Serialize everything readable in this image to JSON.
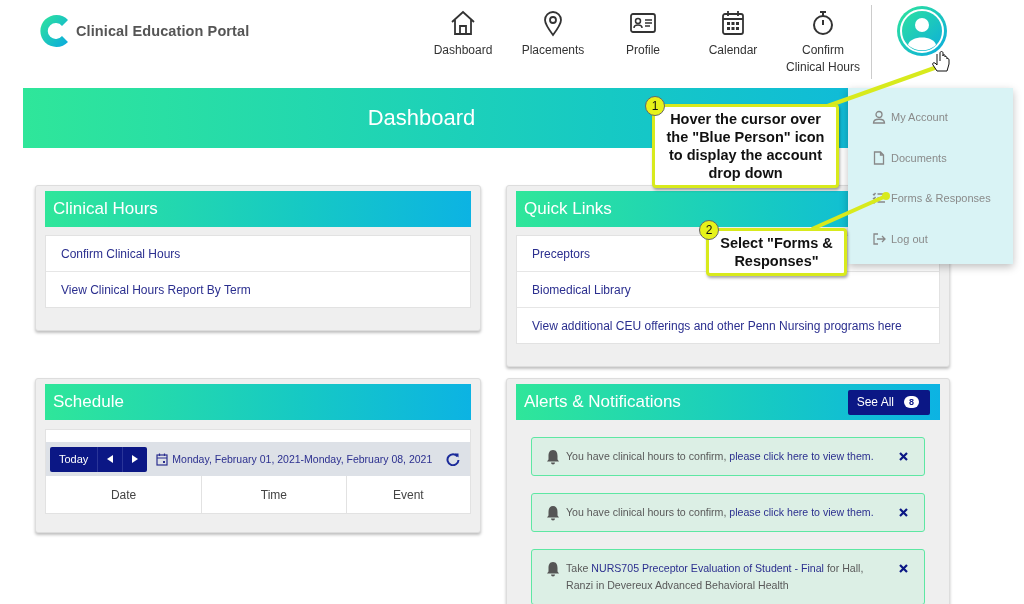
{
  "header": {
    "logo_text": "Clinical Education Portal",
    "nav": [
      {
        "label": "Dashboard"
      },
      {
        "label": "Placements"
      },
      {
        "label": "Profile"
      },
      {
        "label": "Calendar"
      },
      {
        "label": "Confirm Clinical Hours"
      }
    ]
  },
  "banner": {
    "title": "Dashboard"
  },
  "cards": [
    {
      "kind": "links",
      "title": "Clinical Hours",
      "links": [
        "Confirm Clinical Hours",
        "View Clinical Hours Report By Term"
      ]
    },
    {
      "kind": "links",
      "title": "Quick Links",
      "links": [
        "Preceptors",
        "Biomedical Library",
        "View additional CEU offerings and other Penn Nursing programs here"
      ]
    },
    {
      "kind": "schedule",
      "title": "Schedule",
      "today": "Today",
      "range": "Monday, February 01, 2021-Monday, February 08, 2021",
      "columns": [
        "Date",
        "Time",
        "Event"
      ]
    },
    {
      "kind": "alerts",
      "title": "Alerts & Notifications",
      "see_all": "See All",
      "count": "8",
      "alerts": [
        {
          "parts": [
            {
              "text": "You have clinical hours to confirm, ",
              "link": false
            },
            {
              "text": "please click here to view them.",
              "link": true
            }
          ]
        },
        {
          "parts": [
            {
              "text": "You have clinical hours to confirm, ",
              "link": false
            },
            {
              "text": "please click here to view them.",
              "link": true
            }
          ]
        },
        {
          "parts": [
            {
              "text": "Take ",
              "link": false
            },
            {
              "text": "NURS705 Preceptor Evaluation of Student - Final",
              "link": true
            },
            {
              "text": " for Hall, Ranzi in Devereux Advanced Behavioral Health",
              "link": false
            }
          ]
        }
      ]
    }
  ],
  "account_menu": {
    "items": [
      {
        "label": "My Account"
      },
      {
        "label": "Documents"
      },
      {
        "label": "Forms & Responses"
      },
      {
        "label": "Log out"
      }
    ]
  },
  "callouts": [
    {
      "number": "1",
      "text": "Hover the cursor over the \"Blue Person\" icon to display the account drop down"
    },
    {
      "number": "2",
      "text": "Select \"Forms & Responses\""
    }
  ]
}
